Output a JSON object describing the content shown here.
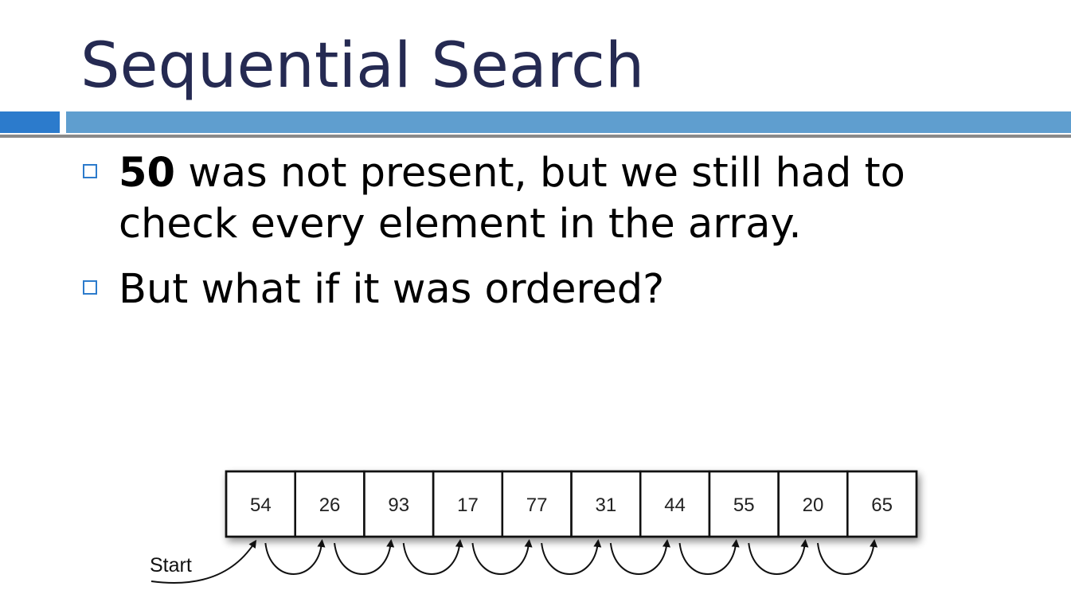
{
  "slide": {
    "title": "Sequential Search",
    "bullets": [
      {
        "bold": "50",
        "line1": " was not present, but we still had to",
        "line2": "check every element in the array."
      },
      {
        "text": "But what if it was ordered?"
      }
    ]
  },
  "diagram": {
    "values": [
      "54",
      "26",
      "93",
      "17",
      "77",
      "31",
      "44",
      "55",
      "20",
      "65"
    ],
    "start_label": "Start"
  },
  "colors": {
    "title": "#252a52",
    "accent_bar": "#5f9ecf",
    "accent_dark": "#2c7bcc"
  }
}
